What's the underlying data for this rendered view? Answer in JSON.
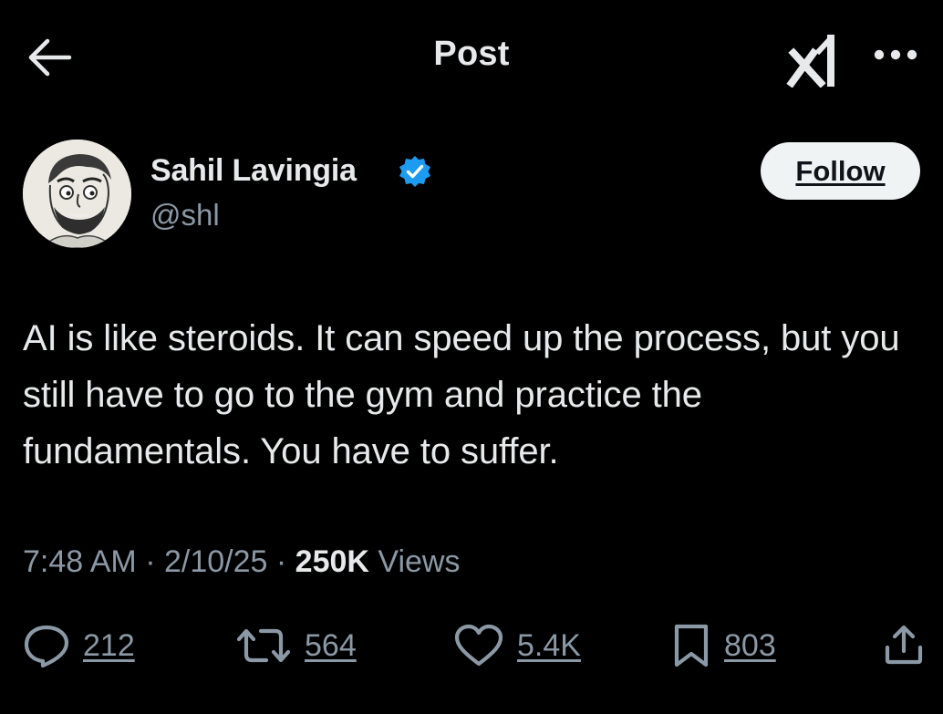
{
  "header": {
    "title": "Post",
    "back_icon": "arrow-left-icon",
    "grok_icon": "grok-logo-icon",
    "more_icon": "more-horizontal-icon"
  },
  "author": {
    "name": "Sahil Lavingia",
    "handle": "@shl",
    "verified": true,
    "verified_color": "#1d9bf0",
    "follow_label": "Follow"
  },
  "post": {
    "text": "AI is like steroids. It can speed up the process, but you still have to go to the gym and practice the fundamentals. You have to suffer.",
    "time": "7:48 AM",
    "date": "2/10/25",
    "views_count": "250K",
    "views_label": "Views"
  },
  "actions": {
    "replies": "212",
    "reposts": "564",
    "likes": "5.4K",
    "bookmarks": "803"
  },
  "colors": {
    "background": "#000000",
    "text": "#e7e9ea",
    "muted": "#8b98a5",
    "follow_bg": "#eff3f4"
  }
}
